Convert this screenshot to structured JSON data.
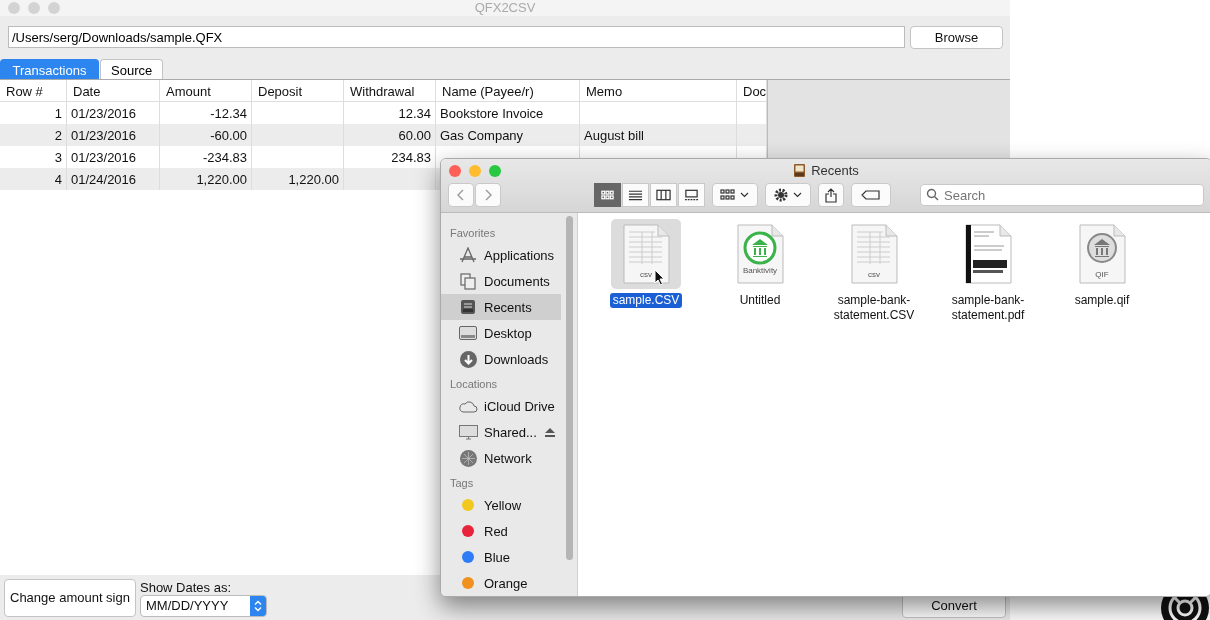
{
  "window": {
    "title": "QFX2CSV"
  },
  "path_field": {
    "value": "/Users/serg/Downloads/sample.QFX"
  },
  "browse_button": "Browse",
  "tabs": [
    {
      "label": "Transactions",
      "selected": true
    },
    {
      "label": "Source",
      "selected": false
    }
  ],
  "table": {
    "columns": [
      "Row #",
      "Date",
      "Amount",
      "Deposit",
      "Withdrawal",
      "Name (Payee/r)",
      "Memo",
      "Doc"
    ],
    "rows": [
      [
        "1",
        "01/23/2016",
        "-12.34",
        "",
        "12.34",
        "Bookstore Invoice",
        "",
        ""
      ],
      [
        "2",
        "01/23/2016",
        "-60.00",
        "",
        "60.00",
        "Gas Company",
        "August bill",
        ""
      ],
      [
        "3",
        "01/23/2016",
        "-234.83",
        "",
        "234.83",
        "",
        "",
        ""
      ],
      [
        "4",
        "01/24/2016",
        "1,220.00",
        "1,220.00",
        "",
        "",
        "",
        ""
      ]
    ]
  },
  "change_sign_button": "Change amount sign",
  "date_format": {
    "label": "Show Dates as:",
    "value": "MM/DD/YYYY"
  },
  "convert_button": "Convert",
  "finder": {
    "title": "Recents",
    "views": [
      {
        "kind": "icons",
        "selected": true
      },
      {
        "kind": "list",
        "selected": false
      },
      {
        "kind": "columns",
        "selected": false
      },
      {
        "kind": "gallery",
        "selected": false
      }
    ],
    "search": {
      "placeholder": "Search"
    },
    "sidebar": [
      {
        "heading": "Favorites",
        "items": [
          {
            "label": "Applications",
            "selected": false
          },
          {
            "label": "Documents",
            "selected": false
          },
          {
            "label": "Recents",
            "selected": true
          },
          {
            "label": "Desktop",
            "selected": false
          },
          {
            "label": "Downloads",
            "selected": false
          }
        ]
      },
      {
        "heading": "Locations",
        "items": [
          {
            "label": "iCloud Drive",
            "selected": false
          },
          {
            "label": "Shared...",
            "selected": false,
            "eject": true
          },
          {
            "label": "Network",
            "selected": false
          }
        ]
      },
      {
        "heading": "Tags",
        "items": [
          {
            "label": "Yellow",
            "color": "#f2c81e",
            "selected": false
          },
          {
            "label": "Red",
            "color": "#e8243c",
            "selected": false
          },
          {
            "label": "Blue",
            "color": "#2f7cf6",
            "selected": false
          },
          {
            "label": "Orange",
            "color": "#f0901e",
            "selected": false
          }
        ]
      }
    ],
    "files": [
      {
        "name": "sample.CSV",
        "kind": "csv",
        "badge": "csv",
        "selected": true
      },
      {
        "name": "Untitled",
        "kind": "bank",
        "badge": "Banktivity",
        "selected": false
      },
      {
        "name": "sample-bank-statement.CSV",
        "kind": "csv",
        "badge": "csv",
        "selected": false
      },
      {
        "name": "sample-bank-statement.pdf",
        "kind": "pdf",
        "selected": false
      },
      {
        "name": "sample.qif",
        "kind": "qif",
        "badge": "QIF",
        "selected": false
      }
    ]
  }
}
